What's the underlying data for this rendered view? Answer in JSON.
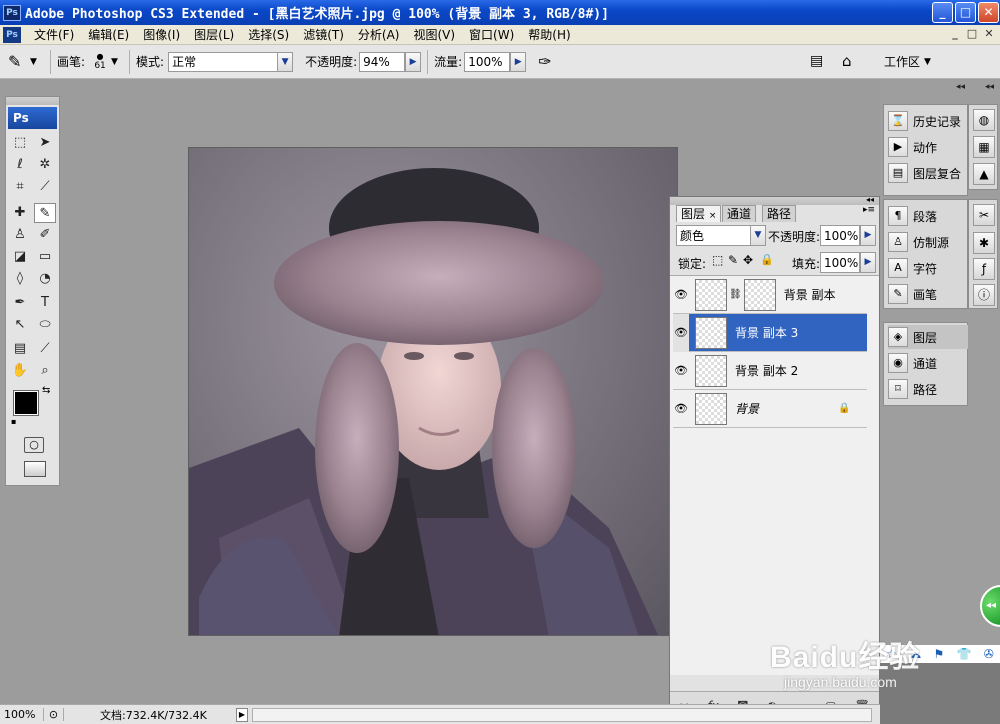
{
  "window": {
    "title": "Adobe Photoshop CS3 Extended - [黑白艺术照片.jpg @ 100% (背景 副本 3, RGB/8#)]",
    "app_icon": "Ps",
    "controls": {
      "minimize": "_",
      "maximize": "□",
      "close": "✕"
    }
  },
  "menubar": {
    "items": [
      "文件(F)",
      "编辑(E)",
      "图像(I)",
      "图层(L)",
      "选择(S)",
      "滤镜(T)",
      "分析(A)",
      "视图(V)",
      "窗口(W)",
      "帮助(H)"
    ],
    "doc_controls": [
      "_",
      "□",
      "✕"
    ]
  },
  "options": {
    "brush_label": "画笔:",
    "brush_size": "61",
    "mode_label": "模式:",
    "mode_value": "正常",
    "opacity_label": "不透明度:",
    "opacity_value": "94%",
    "flow_label": "流量:",
    "flow_value": "100%",
    "workspace_label": "工作区"
  },
  "toolbox": {
    "logo": "Ps"
  },
  "layers_panel": {
    "tabs": [
      "图层",
      "通道",
      "路径"
    ],
    "blend_mode": "颜色",
    "opacity_label": "不透明度:",
    "opacity_value": "100%",
    "lock_label": "锁定:",
    "fill_label": "填充:",
    "fill_value": "100%",
    "layers": [
      {
        "name": "背景 副本",
        "visible": true,
        "selected": false,
        "has_mask": true
      },
      {
        "name": "背景 副本 3",
        "visible": true,
        "selected": true
      },
      {
        "name": "背景 副本 2",
        "visible": true,
        "selected": false
      },
      {
        "name": "背景",
        "visible": true,
        "selected": false,
        "locked": true
      }
    ],
    "bottom_icons": [
      "link-icon",
      "fx-icon",
      "mask-icon",
      "adjustment-icon",
      "folder-icon",
      "new-layer-icon",
      "trash-icon"
    ]
  },
  "dock": {
    "group1": [
      "历史记录",
      "动作",
      "图层复合"
    ],
    "group2": [
      "段落",
      "仿制源",
      "字符",
      "画笔"
    ],
    "group3": [
      "图层",
      "通道",
      "路径"
    ],
    "selected": "图层"
  },
  "status": {
    "zoom": "100%",
    "doc_info": "文档:732.4K/732.4K"
  },
  "watermark": {
    "text": "Baidu经验",
    "url": "jingyan.baidu.com"
  }
}
